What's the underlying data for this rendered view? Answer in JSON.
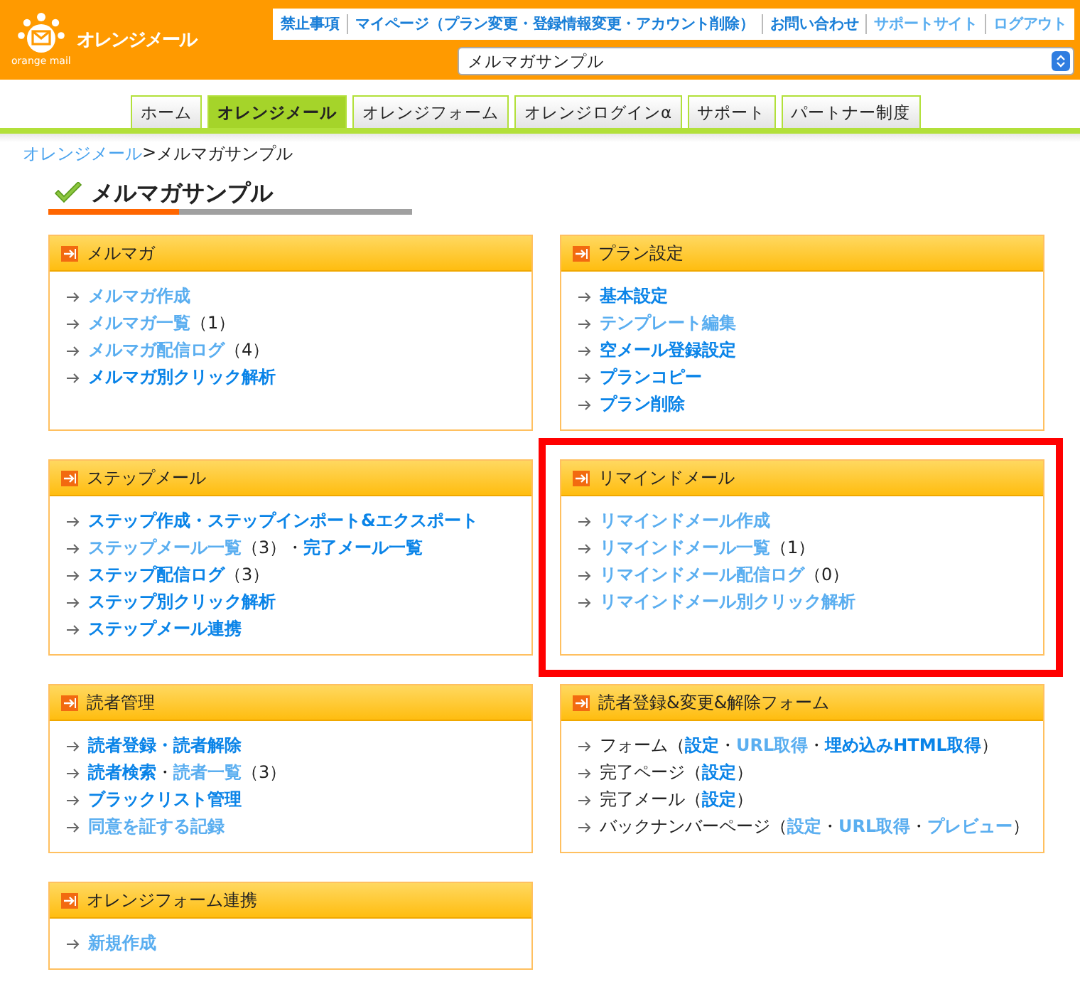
{
  "header": {
    "logo_text": "オレンジメール",
    "logo_subtext": "orange mail",
    "top_links": [
      {
        "text": "禁止事項",
        "visited": false
      },
      {
        "text": "マイページ（プラン変更・登録情報変更・アカウント削除）",
        "visited": false
      },
      {
        "text": "お問い合わせ",
        "visited": false
      },
      {
        "text": "サポートサイト",
        "visited": true
      },
      {
        "text": "ログアウト",
        "visited": true
      }
    ],
    "plan_select": {
      "value": "メルマガサンプル"
    }
  },
  "tabs": [
    {
      "label": "ホーム",
      "selected": false
    },
    {
      "label": "オレンジメール",
      "selected": true
    },
    {
      "label": "オレンジフォーム",
      "selected": false
    },
    {
      "label": "オレンジログインα",
      "selected": false
    },
    {
      "label": "サポート",
      "selected": false
    },
    {
      "label": "パートナー制度",
      "selected": false
    }
  ],
  "breadcrumb": [
    {
      "kind": "link",
      "text": "オレンジメール"
    },
    {
      "kind": "separator",
      "text": ">"
    },
    {
      "kind": "current",
      "text": "メルマガサンプル"
    }
  ],
  "page_title": "メルマガサンプル",
  "panels": [
    {
      "title": "メルマガ",
      "highlighted": false,
      "items": [
        {
          "parts": [
            {
              "kind": "link",
              "text": "メルマガ作成",
              "visited": true
            }
          ]
        },
        {
          "parts": [
            {
              "kind": "link",
              "text": "メルマガ一覧",
              "visited": true
            },
            {
              "kind": "text",
              "text": "（1）"
            }
          ]
        },
        {
          "parts": [
            {
              "kind": "link",
              "text": "メルマガ配信ログ",
              "visited": true
            },
            {
              "kind": "text",
              "text": "（4）"
            }
          ]
        },
        {
          "parts": [
            {
              "kind": "link",
              "text": "メルマガ別クリック解析",
              "visited": false
            }
          ]
        }
      ]
    },
    {
      "title": "プラン設定",
      "highlighted": false,
      "items": [
        {
          "parts": [
            {
              "kind": "link",
              "text": "基本設定",
              "visited": false
            }
          ]
        },
        {
          "parts": [
            {
              "kind": "link",
              "text": "テンプレート編集",
              "visited": true
            }
          ]
        },
        {
          "parts": [
            {
              "kind": "link",
              "text": "空メール登録設定",
              "visited": false
            }
          ]
        },
        {
          "parts": [
            {
              "kind": "link",
              "text": "プランコピー",
              "visited": false
            }
          ]
        },
        {
          "parts": [
            {
              "kind": "link",
              "text": "プラン削除",
              "visited": false
            }
          ]
        }
      ]
    },
    {
      "title": "ステップメール",
      "highlighted": false,
      "items": [
        {
          "parts": [
            {
              "kind": "link",
              "text": "ステップ作成・ステップインポート&エクスポート",
              "visited": false
            }
          ]
        },
        {
          "parts": [
            {
              "kind": "link",
              "text": "ステップメール一覧",
              "visited": true
            },
            {
              "kind": "text",
              "text": "（3）"
            },
            {
              "kind": "text",
              "text": "・"
            },
            {
              "kind": "link",
              "text": "完了メール一覧",
              "visited": false
            }
          ]
        },
        {
          "parts": [
            {
              "kind": "link",
              "text": "ステップ配信ログ",
              "visited": false
            },
            {
              "kind": "text",
              "text": "（3）"
            }
          ]
        },
        {
          "parts": [
            {
              "kind": "link",
              "text": "ステップ別クリック解析",
              "visited": false
            }
          ]
        },
        {
          "parts": [
            {
              "kind": "link",
              "text": "ステップメール連携",
              "visited": false
            }
          ]
        }
      ]
    },
    {
      "title": "リマインドメール",
      "highlighted": true,
      "items": [
        {
          "parts": [
            {
              "kind": "link",
              "text": "リマインドメール作成",
              "visited": true
            }
          ]
        },
        {
          "parts": [
            {
              "kind": "link",
              "text": "リマインドメール一覧",
              "visited": true
            },
            {
              "kind": "text",
              "text": "（1）"
            }
          ]
        },
        {
          "parts": [
            {
              "kind": "link",
              "text": "リマインドメール配信ログ",
              "visited": true
            },
            {
              "kind": "text",
              "text": "（0）"
            }
          ]
        },
        {
          "parts": [
            {
              "kind": "link",
              "text": "リマインドメール別クリック解析",
              "visited": true
            }
          ]
        }
      ]
    },
    {
      "title": "読者管理",
      "highlighted": false,
      "items": [
        {
          "parts": [
            {
              "kind": "link",
              "text": "読者登録・読者解除",
              "visited": false
            }
          ]
        },
        {
          "parts": [
            {
              "kind": "link",
              "text": "読者検索",
              "visited": false
            },
            {
              "kind": "text",
              "text": "・"
            },
            {
              "kind": "link",
              "text": "読者一覧",
              "visited": true
            },
            {
              "kind": "text",
              "text": "（3）"
            }
          ]
        },
        {
          "parts": [
            {
              "kind": "link",
              "text": "ブラックリスト管理",
              "visited": false
            }
          ]
        },
        {
          "parts": [
            {
              "kind": "link",
              "text": "同意を証する記録",
              "visited": true
            }
          ]
        }
      ]
    },
    {
      "title": "読者登録&変更&解除フォーム",
      "highlighted": false,
      "items": [
        {
          "parts": [
            {
              "kind": "text",
              "text": "フォーム（"
            },
            {
              "kind": "link",
              "text": "設定",
              "visited": false
            },
            {
              "kind": "text",
              "text": "・"
            },
            {
              "kind": "link",
              "text": "URL取得",
              "visited": true
            },
            {
              "kind": "text",
              "text": "・"
            },
            {
              "kind": "link",
              "text": "埋め込みHTML取得",
              "visited": false
            },
            {
              "kind": "text",
              "text": "）"
            }
          ]
        },
        {
          "parts": [
            {
              "kind": "text",
              "text": "完了ページ（"
            },
            {
              "kind": "link",
              "text": "設定",
              "visited": false
            },
            {
              "kind": "text",
              "text": "）"
            }
          ]
        },
        {
          "parts": [
            {
              "kind": "text",
              "text": "完了メール（"
            },
            {
              "kind": "link",
              "text": "設定",
              "visited": false
            },
            {
              "kind": "text",
              "text": "）"
            }
          ]
        },
        {
          "parts": [
            {
              "kind": "text",
              "text": "バックナンバーページ（"
            },
            {
              "kind": "link",
              "text": "設定",
              "visited": true
            },
            {
              "kind": "text",
              "text": "・"
            },
            {
              "kind": "link",
              "text": "URL取得",
              "visited": true
            },
            {
              "kind": "text",
              "text": "・"
            },
            {
              "kind": "link",
              "text": "プレビュー",
              "visited": true
            },
            {
              "kind": "text",
              "text": "）"
            }
          ]
        }
      ]
    },
    {
      "title": "オレンジフォーム連携",
      "highlighted": false,
      "items": [
        {
          "parts": [
            {
              "kind": "link",
              "text": "新規作成",
              "visited": true
            }
          ]
        }
      ]
    }
  ]
}
